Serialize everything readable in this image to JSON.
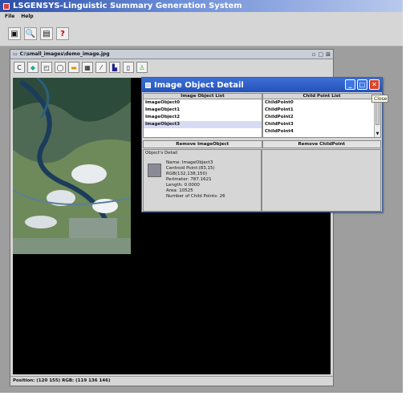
{
  "app": {
    "title": "LSGENSYS-Linguistic Summary Generation System",
    "menu": [
      "File",
      "Help"
    ]
  },
  "image_frame": {
    "title": "C:\\small_images\\demo_image.jpg",
    "status": "Position: (120 155) RGB: (119 136 146)"
  },
  "dialog": {
    "title": "Image Object Detail",
    "close_tooltip": "Close",
    "image_object_list_header": "Image Object List",
    "child_point_list_header": "Child Point List",
    "image_objects": [
      "ImageObject0",
      "ImageObject1",
      "ImageObject2",
      "ImageObject3"
    ],
    "selected_object": "ImageObject3",
    "child_points": [
      "ChildPoint0",
      "ChildPoint1",
      "ChildPoint2",
      "ChildPoint3",
      "ChildPoint4"
    ],
    "remove_object_label": "Remove ImageObject",
    "remove_child_label": "Remove ChildPoint",
    "detail_legend": "Object's Detail",
    "detail": {
      "name": "Name: ImageObject3",
      "centroid": "Centroid Point:(83,15)",
      "rgb": "RGB(132,138,150)",
      "perimeter": "Perimeter: 787.1621",
      "length": "Length: 0.0000",
      "area": "Area: 10525",
      "child_points": "Number of Child Points: 26"
    },
    "swatch_color": "#84 8a96"
  }
}
